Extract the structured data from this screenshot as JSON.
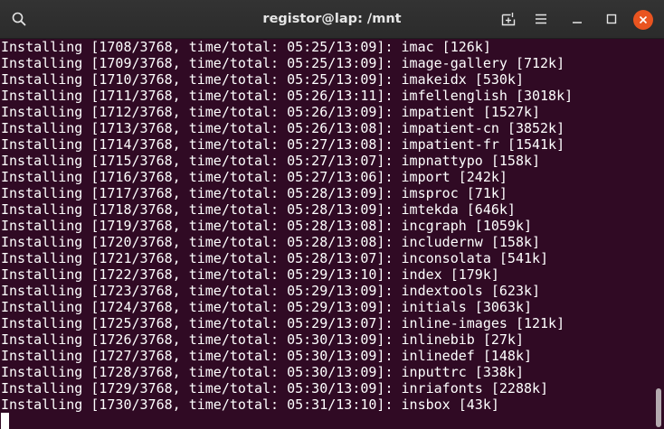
{
  "window": {
    "title": "registor@lap: /mnt"
  },
  "titlebar_icons": {
    "search": "search-icon",
    "new_tab": "new-tab-icon",
    "menu": "hamburger-menu-icon",
    "minimize": "minimize-icon",
    "maximize": "maximize-icon",
    "close": "close-icon"
  },
  "colors": {
    "terminal_background": "#300a24",
    "terminal_text": "#ffffff",
    "titlebar_background": "#2f2f2f",
    "close_button": "#e95420"
  },
  "terminal": {
    "lines": [
      "Installing [1708/3768, time/total: 05:25/13:09]: imac [126k]",
      "Installing [1709/3768, time/total: 05:25/13:09]: image-gallery [712k]",
      "Installing [1710/3768, time/total: 05:25/13:09]: imakeidx [530k]",
      "Installing [1711/3768, time/total: 05:26/13:11]: imfellenglish [3018k]",
      "Installing [1712/3768, time/total: 05:26/13:09]: impatient [1527k]",
      "Installing [1713/3768, time/total: 05:26/13:08]: impatient-cn [3852k]",
      "Installing [1714/3768, time/total: 05:27/13:08]: impatient-fr [1541k]",
      "Installing [1715/3768, time/total: 05:27/13:07]: impnattypo [158k]",
      "Installing [1716/3768, time/total: 05:27/13:06]: import [242k]",
      "Installing [1717/3768, time/total: 05:28/13:09]: imsproc [71k]",
      "Installing [1718/3768, time/total: 05:28/13:09]: imtekda [646k]",
      "Installing [1719/3768, time/total: 05:28/13:08]: incgraph [1059k]",
      "Installing [1720/3768, time/total: 05:28/13:08]: includernw [158k]",
      "Installing [1721/3768, time/total: 05:28/13:07]: inconsolata [541k]",
      "Installing [1722/3768, time/total: 05:29/13:10]: index [179k]",
      "Installing [1723/3768, time/total: 05:29/13:09]: indextools [623k]",
      "Installing [1724/3768, time/total: 05:29/13:09]: initials [3063k]",
      "Installing [1725/3768, time/total: 05:29/13:07]: inline-images [121k]",
      "Installing [1726/3768, time/total: 05:30/13:09]: inlinebib [27k]",
      "Installing [1727/3768, time/total: 05:30/13:09]: inlinedef [148k]",
      "Installing [1728/3768, time/total: 05:30/13:09]: inputtrc [338k]",
      "Installing [1729/3768, time/total: 05:30/13:09]: inriafonts [2288k]",
      "Installing [1730/3768, time/total: 05:31/13:10]: insbox [43k]"
    ]
  },
  "scrollbar": {
    "position_fraction": 0.9
  }
}
